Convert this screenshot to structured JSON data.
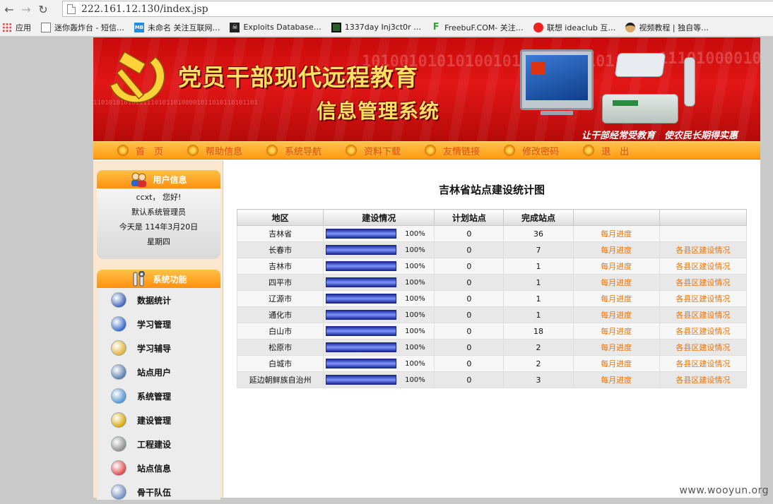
{
  "browser": {
    "url": "222.161.12.130/index.jsp",
    "bookmarks": [
      {
        "label": "应用",
        "icon": "apps-grid-icon"
      },
      {
        "label": "迷你轰炸台 - 短信…",
        "icon": "page-icon"
      },
      {
        "label": "未命名 关注互联网…",
        "icon": "mb-icon"
      },
      {
        "label": "Exploits Database…",
        "icon": "exploit-db-icon"
      },
      {
        "label": "1337day Inj3ct0r …",
        "icon": "1337day-icon"
      },
      {
        "label": "FreebuF.COM- 关注…",
        "icon": "freebuf-icon"
      },
      {
        "label": "联想 ideaclub 互…",
        "icon": "lenovo-icon"
      },
      {
        "label": "视频教程 | 独自等…",
        "icon": "face-icon"
      }
    ]
  },
  "banner": {
    "title": "党员干部现代远程教育",
    "subtitle": "信息管理系统",
    "slogan": "让干部经常受教育　使农民长期得实惠",
    "binary1": "101001010101001010010111101",
    "binary2": "1101010101011111010110100001011010110101101",
    "binary3": "11101000010110"
  },
  "menu": [
    "首　页",
    "帮助信息",
    "系统导航",
    "资料下载",
    "友情链接",
    "修改密码",
    "退　出"
  ],
  "user_panel": {
    "heading": "用户信息",
    "greeting": "ccxt， 您好!",
    "role": "默认系统管理员",
    "date": "今天是 114年3月20日",
    "weekday": "星期四"
  },
  "func_panel": {
    "heading": "系统功能",
    "items": [
      "数据统计",
      "学习管理",
      "学习辅导",
      "站点用户",
      "系统管理",
      "建设管理",
      "工程建设",
      "站点信息",
      "骨干队伍"
    ]
  },
  "main": {
    "title": "吉林省站点建设统计图",
    "headers": [
      "地区",
      "建设情况",
      "计划站点",
      "完成站点",
      "",
      ""
    ],
    "rows": [
      {
        "region": "吉林省",
        "progress": 100,
        "pct": "100%",
        "planned": "0",
        "done": "36",
        "monthly": "每月进度",
        "county": ""
      },
      {
        "region": "长春市",
        "progress": 100,
        "pct": "100%",
        "planned": "0",
        "done": "7",
        "monthly": "每月进度",
        "county": "各县区建设情况"
      },
      {
        "region": "吉林市",
        "progress": 100,
        "pct": "100%",
        "planned": "0",
        "done": "1",
        "monthly": "每月进度",
        "county": "各县区建设情况"
      },
      {
        "region": "四平市",
        "progress": 100,
        "pct": "100%",
        "planned": "0",
        "done": "1",
        "monthly": "每月进度",
        "county": "各县区建设情况"
      },
      {
        "region": "辽源市",
        "progress": 100,
        "pct": "100%",
        "planned": "0",
        "done": "1",
        "monthly": "每月进度",
        "county": "各县区建设情况"
      },
      {
        "region": "通化市",
        "progress": 100,
        "pct": "100%",
        "planned": "0",
        "done": "1",
        "monthly": "每月进度",
        "county": "各县区建设情况"
      },
      {
        "region": "白山市",
        "progress": 100,
        "pct": "100%",
        "planned": "0",
        "done": "18",
        "monthly": "每月进度",
        "county": "各县区建设情况"
      },
      {
        "region": "松原市",
        "progress": 100,
        "pct": "100%",
        "planned": "0",
        "done": "2",
        "monthly": "每月进度",
        "county": "各县区建设情况"
      },
      {
        "region": "白城市",
        "progress": 100,
        "pct": "100%",
        "planned": "0",
        "done": "2",
        "monthly": "每月进度",
        "county": "各县区建设情况"
      },
      {
        "region": "延边朝鲜族自治州",
        "progress": 100,
        "pct": "100%",
        "planned": "0",
        "done": "3",
        "monthly": "每月进度",
        "county": "各县区建设情况"
      }
    ]
  },
  "watermark": "www.wooyun.org",
  "colors": {
    "banner_red": "#d81010",
    "menu_orange": "#ff9a10",
    "link_orange": "#e8750e",
    "bar_blue": "#1c2a96"
  }
}
